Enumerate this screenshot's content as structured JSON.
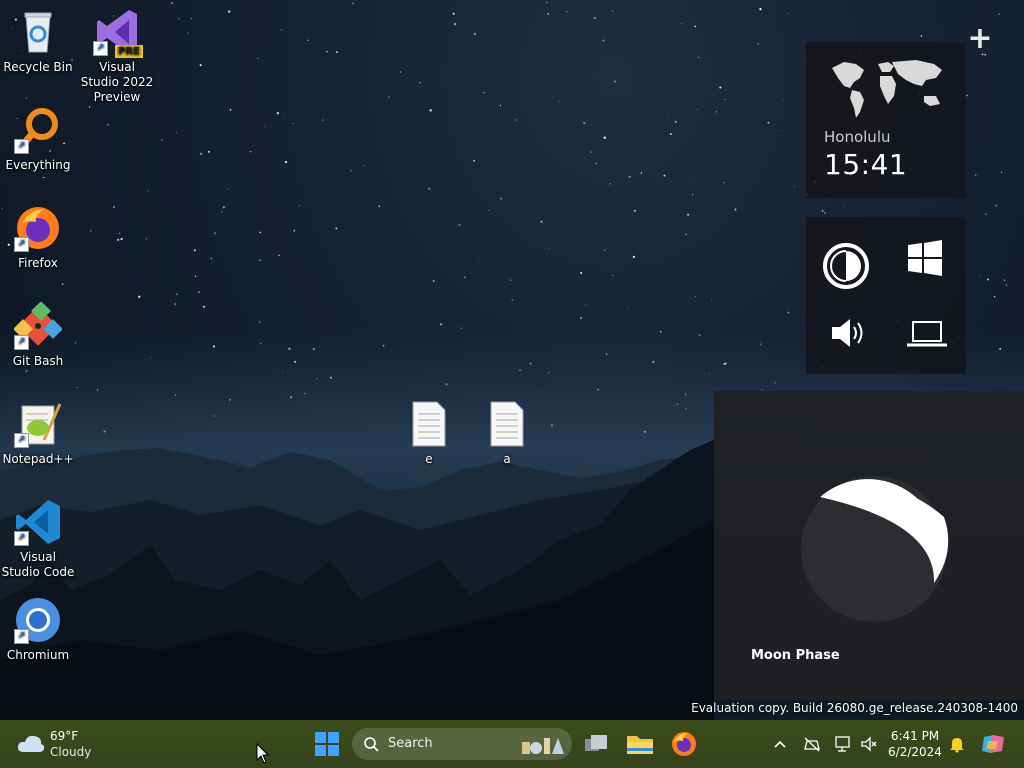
{
  "desktop": {
    "icons": [
      {
        "label": "Recycle Bin"
      },
      {
        "label": "Visual Studio 2022 Preview",
        "badge": "PRE"
      },
      {
        "label": "Everything"
      },
      {
        "label": "Firefox"
      },
      {
        "label": "Git Bash"
      },
      {
        "label": "Notepad++"
      },
      {
        "label": "Visual Studio Code"
      },
      {
        "label": "Chromium"
      }
    ],
    "files": [
      {
        "label": "e"
      },
      {
        "label": "a"
      }
    ]
  },
  "gadgets": {
    "add_symbol": "+",
    "clock": {
      "city": "Honolulu",
      "time": "15:41"
    },
    "moon": {
      "label": "Moon Phase"
    }
  },
  "watermark": "Evaluation copy. Build 26080.ge_release.240308-1400",
  "taskbar": {
    "weather": {
      "temp": "69°F",
      "desc": "Cloudy",
      "icon": "cloud-icon"
    },
    "search_label": "Search",
    "clock": {
      "time": "6:41 PM",
      "date": "6/2/2024"
    },
    "accent": "#3a4a17"
  }
}
